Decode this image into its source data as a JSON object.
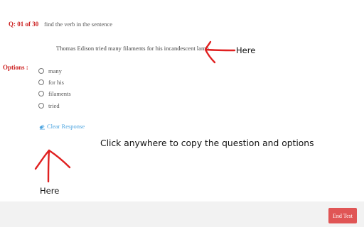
{
  "question": {
    "label": "Q: 01 of 30",
    "instruction": "find the verb in the sentence",
    "sentence": "Thomas Edison tried many filaments for his incandescent lamp."
  },
  "options": {
    "label": "Options :",
    "items": [
      "many",
      "for his",
      "filaments",
      "tried"
    ]
  },
  "clear_response": {
    "label": "Clear Response",
    "icon": "eraser-icon"
  },
  "overlay": {
    "hint": "Click anywhere to copy the question and options",
    "annotation_right": "Here",
    "annotation_bottom": "Here"
  },
  "footer": {
    "end_test_label": "End Test"
  },
  "colors": {
    "accent_red": "#cc2222",
    "link_blue": "#4aa3df",
    "button_red": "#e05555",
    "annotation_red": "#e02020"
  }
}
